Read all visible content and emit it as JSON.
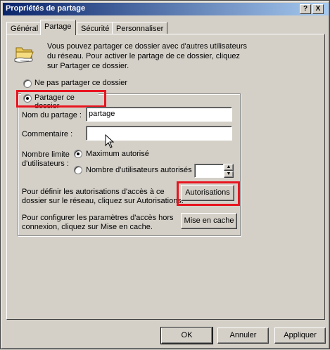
{
  "window": {
    "title": "Propriétés de partage",
    "help_label": "?",
    "close_label": "X"
  },
  "tabs": [
    "Général",
    "Partage",
    "Sécurité",
    "Personnaliser"
  ],
  "intro_text": [
    "Vous pouvez partager ce dossier avec d'autres utilisateurs",
    "du réseau. Pour activer le partage de ce dossier, cliquez",
    "sur Partager ce dossier."
  ],
  "radio_no_share": "Ne pas partager ce dossier",
  "radio_share": "Partager ce dossier",
  "share_name_label": "Nom du partage :",
  "share_name_value": "partage",
  "comment_label": "Commentaire :",
  "comment_value": "",
  "user_limit_label": [
    "Nombre limite",
    "d'utilisateurs :"
  ],
  "limit_max": "Maximum autorisé",
  "limit_count": "Nombre d'utilisateurs autorisés :",
  "limit_count_value": "",
  "permissions_text": [
    "Pour définir les autorisations d'accès à ce",
    "dossier sur le réseau, cliquez sur Autorisations."
  ],
  "permissions_button": "Autorisations",
  "cache_text": [
    "Pour configurer les paramètres d'accès hors",
    "connexion, cliquez sur Mise en cache."
  ],
  "cache_button": "Mise en cache",
  "footer": {
    "ok": "OK",
    "cancel": "Annuler",
    "apply": "Appliquer"
  },
  "colors": {
    "highlight_red": "#e8151f",
    "titlebar_start": "#0a246a",
    "face": "#d4d0c8"
  }
}
